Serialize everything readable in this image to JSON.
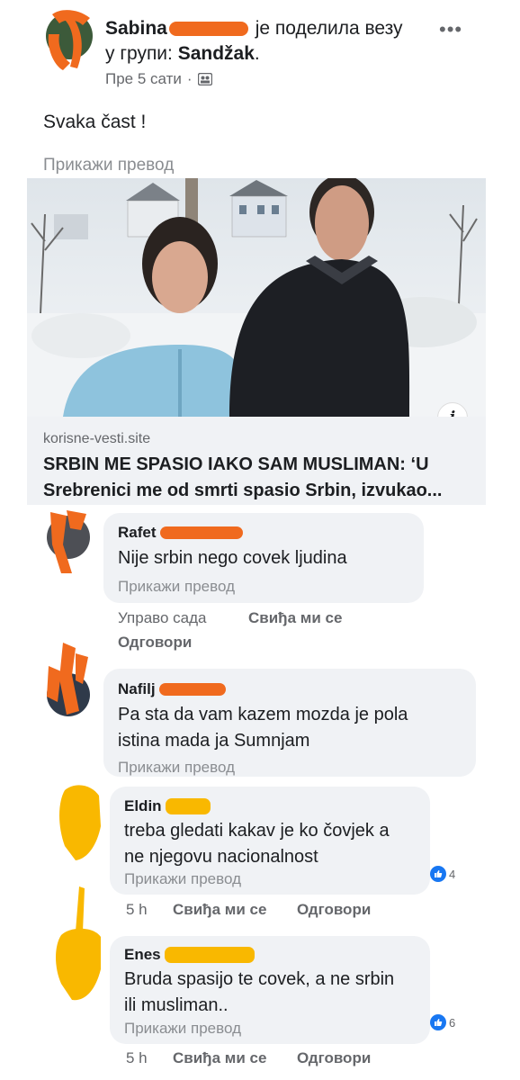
{
  "post": {
    "author_first": "Sabina",
    "header_rest_line1": "je поделила везу",
    "header_line2_prefix": "у групи: ",
    "group_name": "Sandžak",
    "group_suffix": ".",
    "time": "Пре 5 сати",
    "more_icon": "more-dots-icon",
    "text": "Svaka čast !",
    "see_translation": "Прикажи превод"
  },
  "link_card": {
    "domain": "korisne-vesti.site",
    "title_line1": "SRBIN ME SPASIO IAKO SAM MUSLIMAN: ‘U",
    "title_line2": "Srebrenici me od smrti spasio Srbin, izvukao...",
    "info_icon": "i"
  },
  "comments": [
    {
      "name": "Rafet",
      "text_lines": [
        "Nije srbin nego covek ljudina"
      ],
      "see_translation": "Прикажи превод",
      "time": "Управо сада",
      "like": "Свиђа ми се",
      "reply": "Одговори",
      "reactions": ""
    },
    {
      "name": "Nafilj",
      "text_lines": [
        "Pa sta da vam kazem mozda je pola",
        "istina mada ja Sumnjam"
      ],
      "see_translation": "Прикажи превод",
      "time": "",
      "like": "",
      "reply": "",
      "reactions": ""
    },
    {
      "name": "Eldin",
      "text_lines": [
        "treba gledati kakav je ko čovjek a",
        "ne njegovu nacionalnost"
      ],
      "see_translation": "Прикажи превод",
      "time": "5 h",
      "like": "Свиђа ми се",
      "reply": "Одговори",
      "reactions": "4"
    },
    {
      "name": "Enes",
      "text_lines": [
        "Bruda spasijo te covek, a ne srbin",
        "ili musliman.."
      ],
      "see_translation": "Прикажи превод",
      "time": "5 h",
      "like": "Свиђа ми се",
      "reply": "Одговори",
      "reactions": "6"
    }
  ],
  "colors": {
    "redaction_orange": "#f06a1e",
    "redaction_yellow": "#f9b800",
    "like_blue": "#1877f2",
    "bubble_bg": "#f0f2f5"
  }
}
